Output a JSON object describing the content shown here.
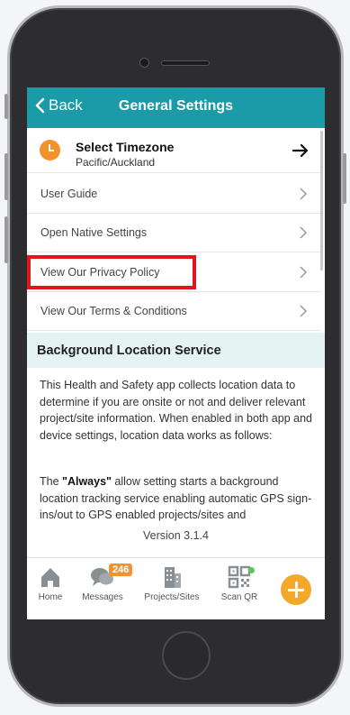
{
  "header": {
    "back_label": "Back",
    "title": "General Settings"
  },
  "timezone": {
    "title": "Select Timezone",
    "value": "Pacific/Auckland"
  },
  "settings_items": [
    {
      "label": "User Guide"
    },
    {
      "label": "Open Native Settings"
    },
    {
      "label": "View Our Privacy Policy"
    },
    {
      "label": "View Our Terms & Conditions"
    }
  ],
  "location_section": {
    "title": "Background Location Service",
    "paragraph_1": "This Health and Safety app collects location data to determine if you are onsite or not and deliver relevant project/site information. When enabled in both app and device settings, location data works as follows:",
    "paragraph_2_prefix": "The ",
    "paragraph_2_bold": "\"Always\"",
    "paragraph_2_rest": " allow setting starts a background location tracking service enabling automatic GPS sign-ins/out to GPS enabled projects/sites and"
  },
  "version": "Version 3.1.4",
  "tabbar": {
    "home": "Home",
    "messages": "Messages",
    "messages_badge": "246",
    "projects": "Projects/Sites",
    "scan": "Scan QR"
  },
  "colors": {
    "header_bg": "#1b9aa7",
    "accent_orange": "#f2922d",
    "highlight_red": "#e5131b",
    "section_bg": "#e6f3f3",
    "fab": "#f2a92b"
  }
}
